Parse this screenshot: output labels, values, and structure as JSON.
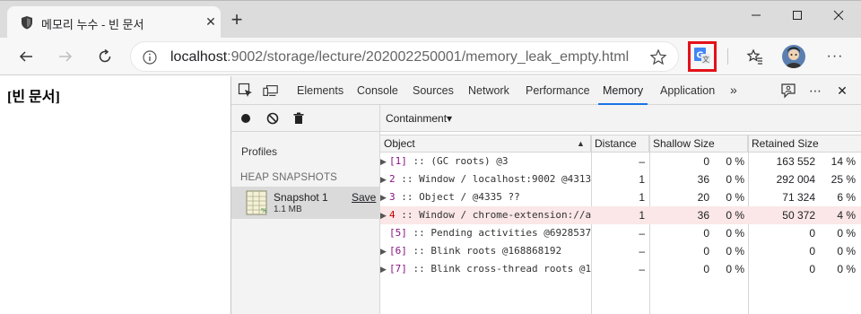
{
  "browser": {
    "tab": {
      "title": "메모리 누수 - 빈 문서",
      "close_symbol": "✕"
    },
    "new_tab_symbol": "+",
    "window": {
      "minimize": "—",
      "maximize": "☐",
      "close": "✕"
    },
    "address": {
      "host": "localhost",
      "rest": ":9002/storage/lecture/202002250001/memory_leak_empty.html"
    },
    "more_symbol": "···",
    "accent_color": "#e3111a"
  },
  "page": {
    "text": "[빈 문서]"
  },
  "devtools": {
    "tabs": [
      "Elements",
      "Console",
      "Sources",
      "Network",
      "Performance",
      "Memory",
      "Application"
    ],
    "active_tab": "Memory",
    "overflow_symbol": "»",
    "close_symbol": "✕",
    "menu_symbol": "⋯",
    "sidebar": {
      "profiles_label": "Profiles",
      "heap_label": "HEAP SNAPSHOTS",
      "snapshot": {
        "name": "Snapshot 1",
        "size": "1.1 MB",
        "save": "Save"
      }
    },
    "view_select": "Containment",
    "view_select_arrow": "▾",
    "columns": {
      "object": "Object",
      "distance": "Distance",
      "shallow": "Shallow Size",
      "retained": "Retained Size",
      "sort_indicator": "▲"
    },
    "rows": [
      {
        "expander": "▶",
        "id": "[1]",
        "label": " :: (GC roots) @3",
        "distance": "–",
        "shallow": "0",
        "shallow_pct": "0 %",
        "retained": "163 552",
        "retained_pct": "14 %",
        "highlight": false
      },
      {
        "expander": "▶",
        "id": "2",
        "label": " :: Window / localhost:9002 @4313",
        "distance": "1",
        "shallow": "36",
        "shallow_pct": "0 %",
        "retained": "292 004",
        "retained_pct": "25 %",
        "highlight": false
      },
      {
        "expander": "▶",
        "id": "3",
        "label": " :: Object /  @4335 ??",
        "distance": "1",
        "shallow": "20",
        "shallow_pct": "0 %",
        "retained": "71 324",
        "retained_pct": "6 %",
        "highlight": false
      },
      {
        "expander": "▶",
        "id": "4",
        "label": " :: Window / chrome-extension://a",
        "distance": "1",
        "shallow": "36",
        "shallow_pct": "0 %",
        "retained": "50 372",
        "retained_pct": "4 %",
        "highlight": true
      },
      {
        "expander": "",
        "id": "[5]",
        "label": " :: Pending activities @6928537",
        "distance": "–",
        "shallow": "0",
        "shallow_pct": "0 %",
        "retained": "0",
        "retained_pct": "0 %",
        "highlight": false
      },
      {
        "expander": "▶",
        "id": "[6]",
        "label": " :: Blink roots @168868192",
        "distance": "–",
        "shallow": "0",
        "shallow_pct": "0 %",
        "retained": "0",
        "retained_pct": "0 %",
        "highlight": false
      },
      {
        "expander": "▶",
        "id": "[7]",
        "label": " :: Blink cross-thread roots @1",
        "distance": "–",
        "shallow": "0",
        "shallow_pct": "0 %",
        "retained": "0",
        "retained_pct": "0 %",
        "highlight": false
      }
    ]
  }
}
